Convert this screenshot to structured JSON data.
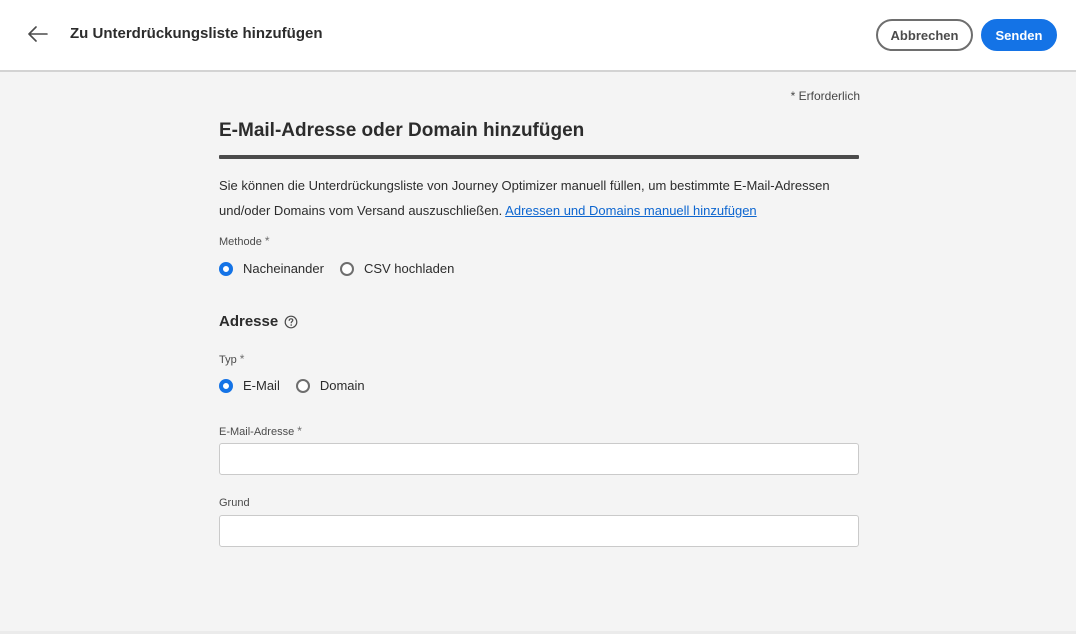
{
  "header": {
    "back_icon": "arrow-left-icon",
    "title": "Zu Unterdrückungsliste hinzufügen",
    "cancel_label": "Abbrechen",
    "send_label": "Senden"
  },
  "form": {
    "required_note": "* Erforderlich",
    "section_title": "E-Mail-Adresse oder Domain hinzufügen",
    "description": "Sie können die Unterdrückungsliste von Journey Optimizer manuell füllen, um bestimmte E-Mail-Adressen und/oder Domains vom Versand auszuschließen.",
    "description_link": "Adressen und Domains manuell hinzufügen",
    "method": {
      "label": "Methode",
      "star": "*",
      "options": [
        {
          "label": "Nacheinander",
          "selected": true
        },
        {
          "label": "CSV hochladen",
          "selected": false
        }
      ]
    },
    "address": {
      "title": "Adresse",
      "help_icon": "help-circle-icon"
    },
    "type": {
      "label": "Typ",
      "star": "*",
      "options": [
        {
          "label": "E-Mail",
          "selected": true
        },
        {
          "label": "Domain",
          "selected": false
        }
      ]
    },
    "email_field": {
      "label": "E-Mail-Adresse",
      "star": "*",
      "value": "",
      "placeholder": ""
    },
    "reason_field": {
      "label": "Grund",
      "value": "",
      "placeholder": ""
    }
  },
  "colors": {
    "accent": "#1473e6",
    "link": "#0d66d0",
    "background": "#f4f4f4"
  }
}
